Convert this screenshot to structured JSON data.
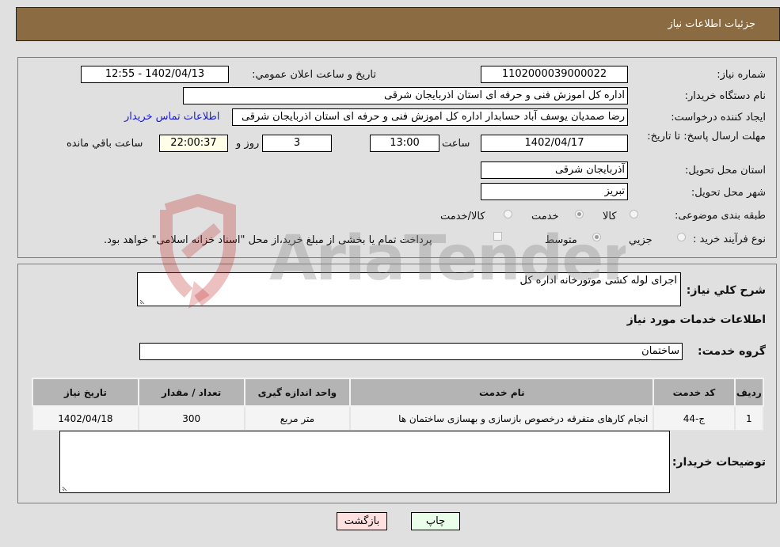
{
  "header": {
    "title": "جزئیات اطلاعات نیاز"
  },
  "details": {
    "need_number_label": "شماره نیاز:",
    "need_number": "1102000039000022",
    "announce_label": "تاریخ و ساعت اعلان عمومي:",
    "announce_value": "1402/04/13 - 12:55",
    "buyer_org_label": "نام دستگاه خريدار:",
    "buyer_org": "اداره کل اموزش فنی و حرفه ای استان اذربایجان شرقی",
    "requester_label": "ایجاد کننده درخواست:",
    "requester": "رضا صمدیان یوسف آباد حسابدار اداره کل اموزش فنی و حرفه ای استان اذربایجان شرقی",
    "contact_link": "اطلاعات تماس خريدار",
    "deadline_label": "مهلت ارسال پاسخ: تا تاریخ:",
    "deadline_date": "1402/04/17",
    "time_label": "ساعت",
    "deadline_time": "13:00",
    "days_value": "3",
    "days_label": "روز و",
    "remaining_time": "22:00:37",
    "remaining_label": "ساعت باقي مانده",
    "province_label": "استان محل تحویل:",
    "province": "آذربایجان شرقی",
    "city_label": "شهر محل تحویل:",
    "city": "تبریز",
    "category_label": "طبقه بندی موضوعی:",
    "category_options": [
      {
        "label": "کالا",
        "selected": false
      },
      {
        "label": "خدمت",
        "selected": true
      },
      {
        "label": "کالا/خدمت",
        "selected": false
      }
    ],
    "process_label": "نوع فرآیند خرید :",
    "process_options": [
      {
        "label": "جزيي",
        "selected": false
      },
      {
        "label": "متوسط",
        "selected": true
      }
    ],
    "treasury_note": "پرداخت تمام یا بخشی از مبلغ خرید،از محل \"اسناد خزانه اسلامی\" خواهد بود.",
    "treasury_checked": false
  },
  "services": {
    "description_label": "شرح کلي نیاز:",
    "description": "اجرای لوله کشی موتورخانه اداره کل",
    "section_title": "اطلاعات خدمات مورد نیاز",
    "group_label": "گروه خدمت:",
    "group": "ساختمان",
    "table": {
      "headers": [
        "ردیف",
        "کد خدمت",
        "نام خدمت",
        "واحد اندازه گیری",
        "تعداد / مقدار",
        "تاریخ نیاز"
      ],
      "rows": [
        [
          "1",
          "ج-44",
          "انجام کارهای متفرقه درخصوص بازسازی و بهسازی ساختمان ها",
          "متر مربع",
          "300",
          "1402/04/18"
        ]
      ]
    },
    "buyer_notes_label": "توضیحات خریدار:",
    "buyer_notes": ""
  },
  "buttons": {
    "print": "چاپ",
    "back": "بازگشت"
  },
  "watermark": {
    "text": "AriaTender.neT"
  },
  "colors": {
    "header_bg": "#8b6b42",
    "print_bg": "#eaffea",
    "back_bg": "#ffe0e0",
    "link": "#1a1ad0"
  }
}
